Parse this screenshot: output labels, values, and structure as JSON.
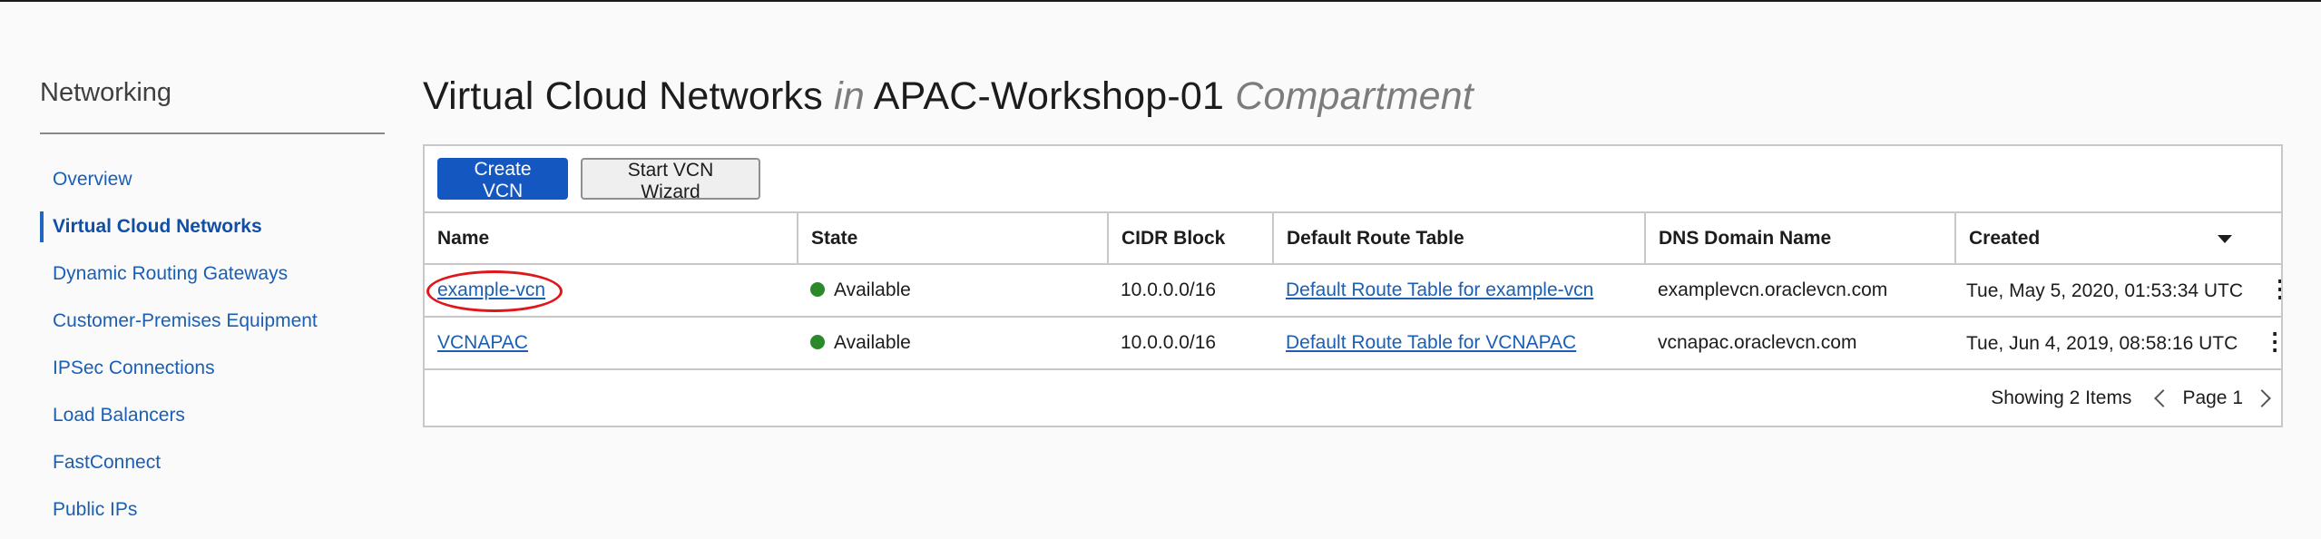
{
  "sidebar": {
    "title": "Networking",
    "items": [
      {
        "label": "Overview"
      },
      {
        "label": "Virtual Cloud Networks"
      },
      {
        "label": "Dynamic Routing Gateways"
      },
      {
        "label": "Customer-Premises Equipment"
      },
      {
        "label": "IPSec Connections"
      },
      {
        "label": "Load Balancers"
      },
      {
        "label": "FastConnect"
      },
      {
        "label": "Public IPs"
      }
    ]
  },
  "header": {
    "title": "Virtual Cloud Networks",
    "in_word": "in",
    "compartment": "APAC-Workshop-01",
    "compartment_word": "Compartment"
  },
  "toolbar": {
    "create_label": "Create VCN",
    "wizard_label": "Start VCN Wizard"
  },
  "table": {
    "columns": [
      "Name",
      "State",
      "CIDR Block",
      "Default Route Table",
      "DNS Domain Name",
      "Created"
    ],
    "rows": [
      {
        "name": "example-vcn",
        "state": "Available",
        "cidr": "10.0.0.0/16",
        "route_table": "Default Route Table for example-vcn",
        "dns": "examplevcn.oraclevcn.com",
        "created": "Tue, May 5, 2020, 01:53:34 UTC"
      },
      {
        "name": "VCNAPAC",
        "state": "Available",
        "cidr": "10.0.0.0/16",
        "route_table": "Default Route Table for VCNAPAC",
        "dns": "vcnapac.oraclevcn.com",
        "created": "Tue, Jun 4, 2019, 08:58:16 UTC"
      }
    ]
  },
  "footer": {
    "showing": "Showing 2 Items",
    "page": "Page 1"
  },
  "colors": {
    "primary_button": "#1557c0",
    "link": "#1a5fb4",
    "status_available": "#2a8a2a",
    "highlight_annotation": "#e0161a"
  }
}
